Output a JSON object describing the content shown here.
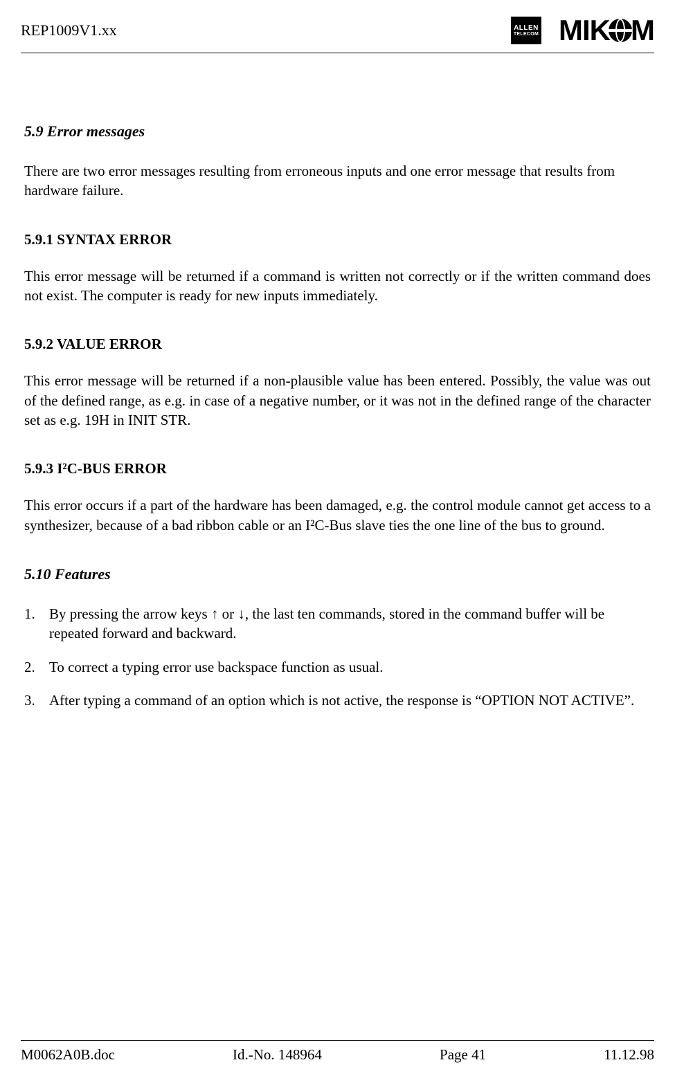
{
  "header": {
    "doc_id": "REP1009V1.xx",
    "allen_line1": "ALLEN",
    "allen_line2": "TELECOM",
    "mikom_pre": "MIK",
    "mikom_post": "M"
  },
  "sections": {
    "s59": {
      "heading": "5.9  Error messages",
      "intro": "There are two error messages resulting from erroneous inputs and one error message that results from hardware failure."
    },
    "s591": {
      "heading": "5.9.1  SYNTAX ERROR",
      "body": "This error message will be returned if a command is written not correctly or if the written command does not exist. The computer is ready for new inputs immediately."
    },
    "s592": {
      "heading": "5.9.2  VALUE ERROR",
      "body": "This error message will be returned if a non-plausible value has been entered. Possibly, the value was out of the defined range, as e.g. in case of a negative number, or it was not in the defined range of the character set as e.g. 19H in INIT STR."
    },
    "s593": {
      "heading": "5.9.3  I²C-BUS ERROR",
      "body": "This error occurs if a part of the hardware has been damaged, e.g. the control module cannot get access to a synthesizer, because of a bad ribbon cable or an I²C-Bus slave ties the one line of the bus to ground."
    },
    "s510": {
      "heading": "5.10  Features",
      "items": [
        "By pressing the arrow keys ↑ or ↓, the last ten commands, stored in the command buffer will be repeated forward and backward.",
        "To correct a typing error use backspace function as usual.",
        "After typing a command of an option which is not active, the response is “OPTION NOT ACTIVE”."
      ]
    }
  },
  "footer": {
    "file": "M0062A0B.doc",
    "idno": "Id.-No. 148964",
    "page": "Page 41",
    "date": "11.12.98"
  }
}
